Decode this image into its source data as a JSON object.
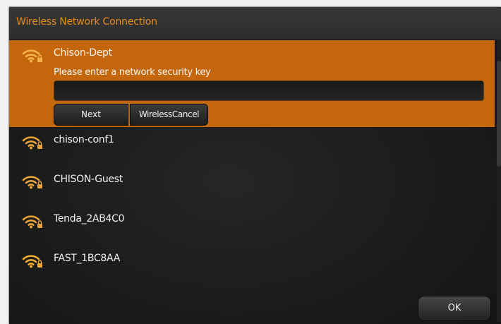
{
  "dialog": {
    "title": "Wireless Network Connection"
  },
  "colors": {
    "accent": "#e58a17",
    "selected_row": "#c4670c",
    "background": "#1b1b1b"
  },
  "networks": [
    {
      "name": "Chison-Dept",
      "icon": "wifi-locked-icon",
      "selected": true
    },
    {
      "name": "chison-conf1",
      "icon": "wifi-locked-icon",
      "selected": false
    },
    {
      "name": "CHISON-Guest",
      "icon": "wifi-locked-icon",
      "selected": false
    },
    {
      "name": "Tenda_2AB4C0",
      "icon": "wifi-locked-icon",
      "selected": false
    },
    {
      "name": "FAST_1BC8AA",
      "icon": "wifi-locked-icon",
      "selected": false
    }
  ],
  "connect": {
    "prompt": "Please enter a network security key",
    "key_value": "",
    "next_label": "Next",
    "cancel_label": "WirelessCancel"
  },
  "footer": {
    "ok_label": "OK"
  }
}
